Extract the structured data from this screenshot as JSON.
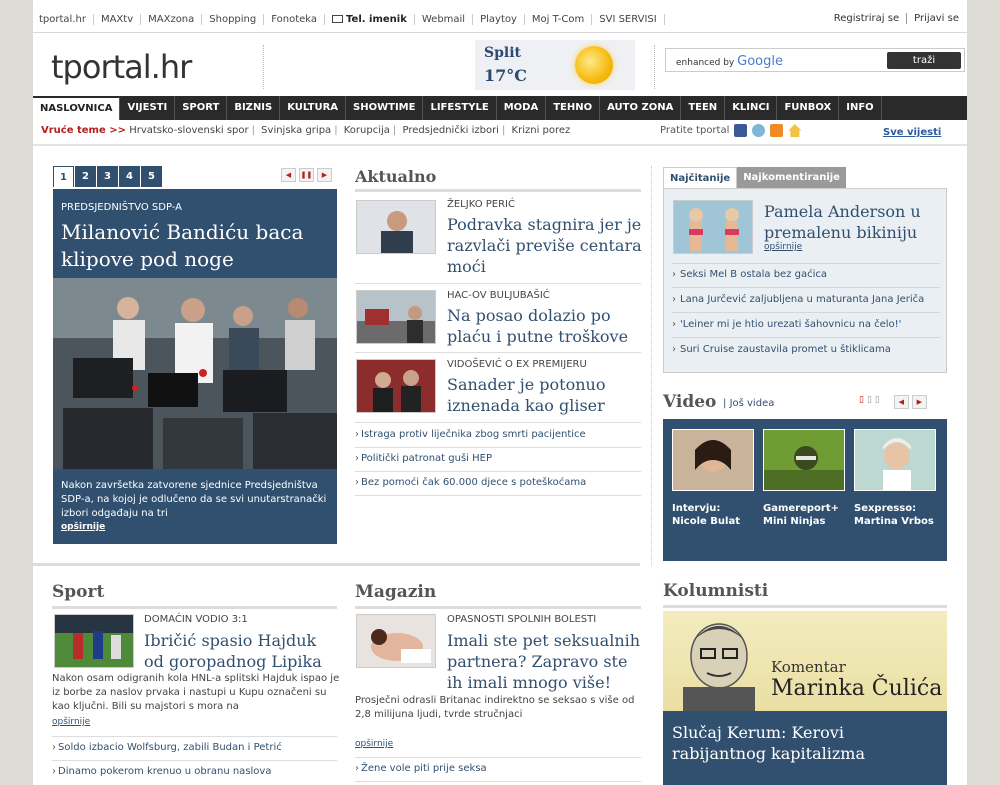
{
  "topbar": {
    "links": [
      "tportal.hr",
      "MAXtv",
      "MAXzona",
      "Shopping",
      "Fonoteka",
      "Tel. imenik",
      "Webmail",
      "Playtoy",
      "Moj T-Com",
      "SVI SERVISI"
    ],
    "register": "Registriraj se",
    "login": "Prijavi se"
  },
  "header": {
    "logo": "tportal.hr",
    "weather_city": "Split",
    "weather_temp": "17°C",
    "search_enhanced": "enhanced by",
    "search_google": "Google",
    "search_button": "traži"
  },
  "nav": [
    "NASLOVNICA",
    "VIJESTI",
    "SPORT",
    "BIZNIS",
    "KULTURA",
    "SHOWTIME",
    "LIFESTYLE",
    "MODA",
    "TEHNO",
    "AUTO ZONA",
    "TEEN",
    "KLINCI",
    "FUNBOX",
    "INFO"
  ],
  "hot": {
    "label": "Vruće teme >>",
    "topics": [
      "Hrvatsko-slovenski spor",
      "Svinjska gripa",
      "Korupcija",
      "Predsjednički izbori",
      "Krizni porez"
    ],
    "follow": "Pratite tportal",
    "all_news": "Sve vijesti"
  },
  "featured": {
    "tabs": [
      "1",
      "2",
      "3",
      "4",
      "5"
    ],
    "kicker": "PREDSJEDNIŠTVO SDP-A",
    "title": "Milanović Bandiću baca klipove pod noge",
    "summary": "Nakon završetka zatvorene sjednice Predsjedništva SDP-a, na kojoj je odlučeno da se svi unutarstranački izbori odgađaju na tri",
    "more": "opširnije"
  },
  "aktualno": {
    "heading": "Aktualno",
    "items": [
      {
        "kicker": "ŽELJKO PERIĆ",
        "title": "Podravka stagnira jer je razvlači previše centara moći"
      },
      {
        "kicker": "HAC-OV BULJUBAŠIĆ",
        "title": "Na posao dolazio po plaću i putne troškove"
      },
      {
        "kicker": "VIDOŠEVIĆ O EX PREMIJERU",
        "title": "Sanader je potonuo iznenada kao gliser"
      }
    ],
    "links": [
      "Istraga protiv liječnika zbog smrti pacijentice",
      "Politički patronat guši HEP",
      "Bez pomoći čak 60.000 djece s poteškoćama"
    ]
  },
  "popular": {
    "tab_read": "Najčitanije",
    "tab_comment": "Najkomentiranije",
    "top_title": "Pamela Anderson u premalenu bikiniju",
    "top_more": "opširnije",
    "links": [
      "Seksi Mel B ostala bez gaćica",
      "Lana Jurčević zaljubljena u maturanta Jana Jeriča",
      "'Leiner mi je htio urezati šahovnicu na čelo!'",
      "Suri Cruise zaustavila promet u štiklicama"
    ]
  },
  "video": {
    "heading": "Video",
    "more": "Još videa",
    "items": [
      "Intervju: Nicole Bulat",
      "Gamereport+ Mini Ninjas",
      "Sexpresso: Martina Vrbos"
    ]
  },
  "sport": {
    "heading": "Sport",
    "kicker": "DOMAĆIN VODIO 3:1",
    "title": "Ibričić spasio Hajduk od goropadnog Lipika",
    "summary": "Nakon osam odigranih kola HNL-a splitski Hajduk ispao je iz borbe za naslov prvaka i nastupi u Kupu označeni su kao ključni. Bili su majstori s mora na",
    "more": "opširnije",
    "links": [
      "Soldo izbacio Wolfsburg, zabili Budan i Petrić",
      "Dinamo pokerom krenuo u obranu naslova"
    ]
  },
  "magazin": {
    "heading": "Magazin",
    "kicker": "OPASNOSTI SPOLNIH BOLESTI",
    "title": "Imali ste pet seksualnih partnera? Zapravo ste ih imali mnogo više!",
    "summary": "Prosječni odrasli Britanac indirektno se seksao s više od 2,8 milijuna ljudi, tvrde stručnjaci",
    "more": "opširnije",
    "links": [
      "Žene vole piti prije seksa"
    ]
  },
  "kolumnisti": {
    "heading": "Kolumnisti",
    "komentar": "Komentar",
    "author": "Marinka Čulića",
    "title": "Slučaj Kerum: Kerovi rabijantnog kapitalizma"
  },
  "colors": {
    "accent": "#31506f",
    "nav_bg": "#2a2a2a",
    "hot_label": "#b41e1e"
  }
}
